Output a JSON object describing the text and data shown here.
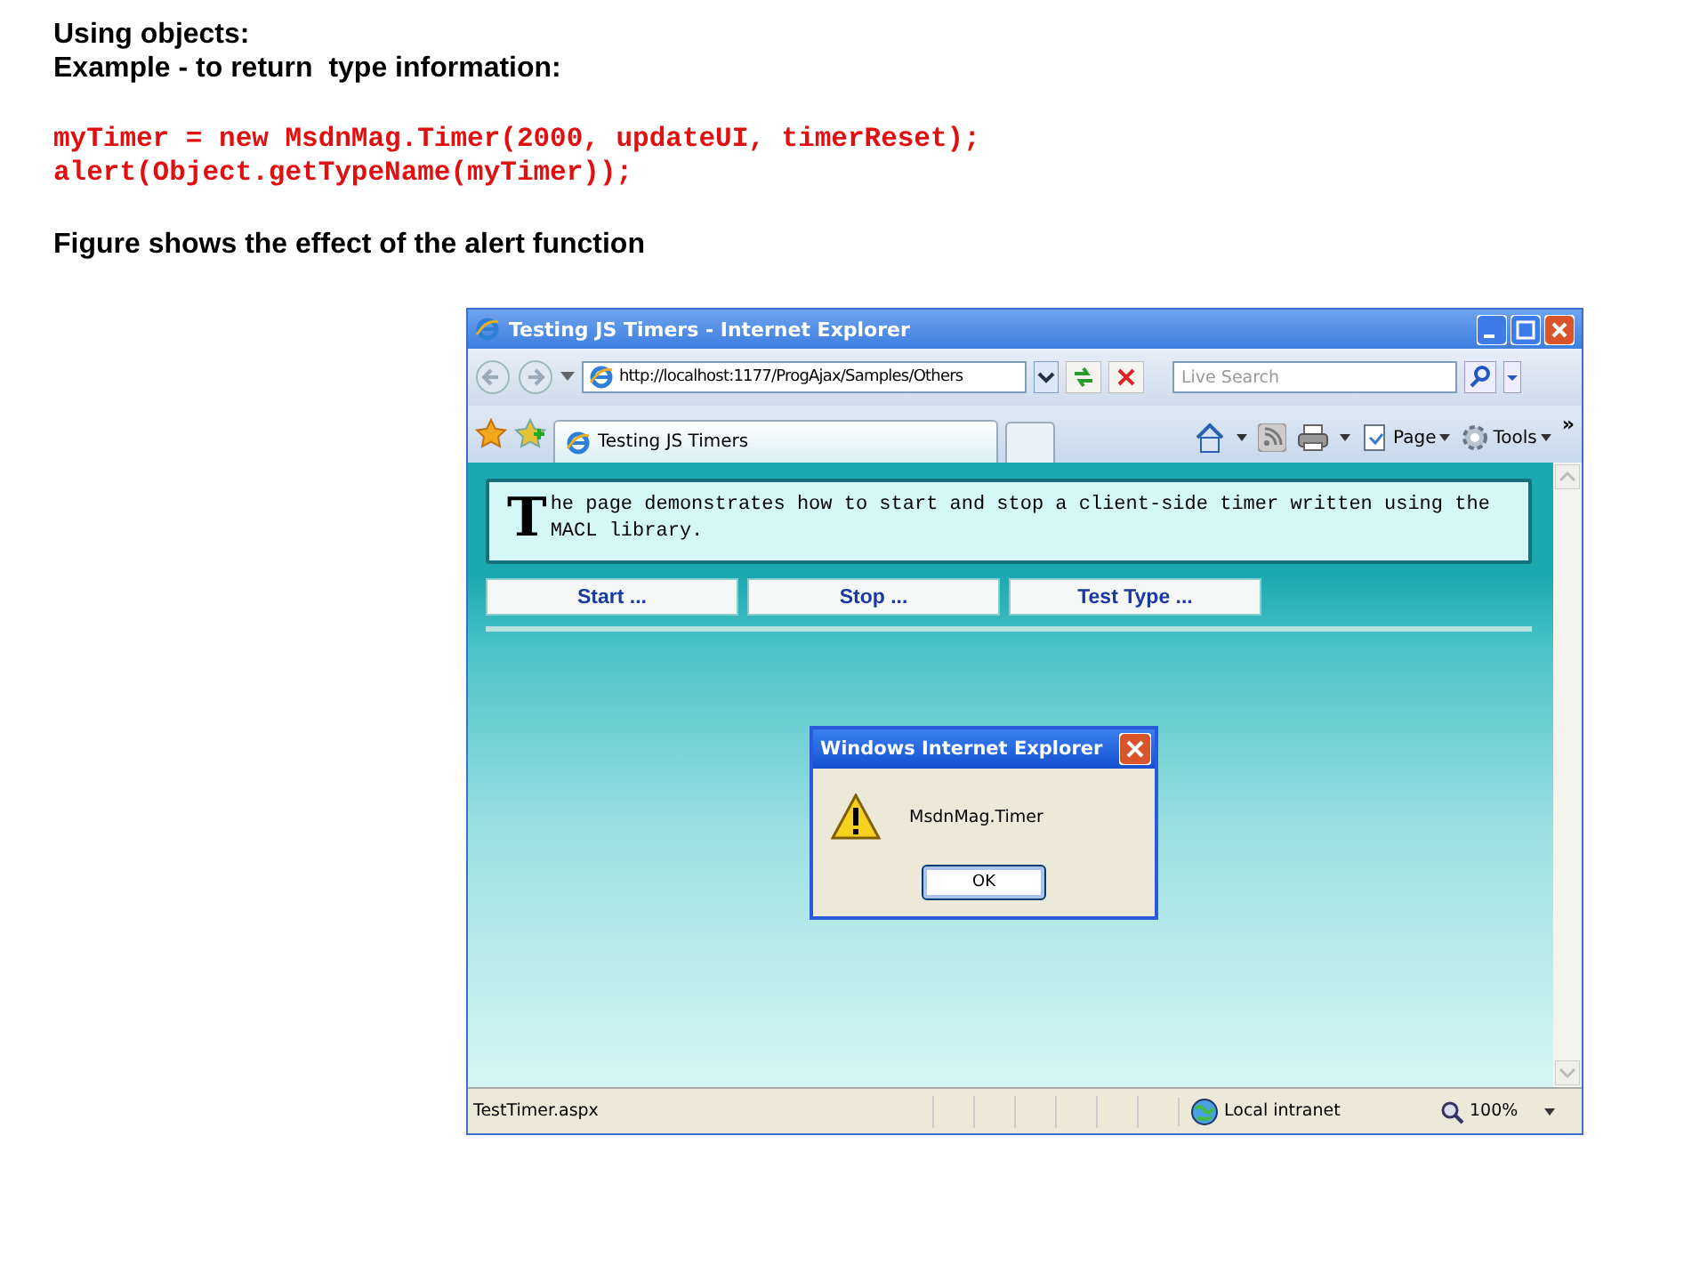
{
  "slide": {
    "heading": "Using objects:",
    "subheading": "Example - to return  type information:",
    "code": [
      "myTimer = new MsdnMag.Timer(2000, updateUI, timerReset);",
      "alert(Object.getTypeName(myTimer));"
    ],
    "caption": "Figure shows the effect of the alert function"
  },
  "window": {
    "title": "Testing JS Timers - Internet Explorer"
  },
  "address_bar": {
    "url": "http://localhost:1177/ProgAjax/Samples/Others"
  },
  "search": {
    "placeholder": "Live Search"
  },
  "tabs": [
    {
      "label": "Testing JS Timers",
      "selected": true
    }
  ],
  "toolbar": [
    {
      "label": "Page"
    },
    {
      "label": "Tools"
    }
  ],
  "toolbar_more": "»",
  "page": {
    "intro_initial": "T",
    "intro": "he page demonstrates how to start and stop a client-side timer written using the MACL library.",
    "buttons": [
      "Start ...",
      "Stop ...",
      "Test Type ..."
    ]
  },
  "dialog": {
    "title": "Windows Internet Explorer",
    "message": "MsdnMag.Timer",
    "button": "OK"
  },
  "status_bar": {
    "text": "TestTimer.aspx",
    "zone": "Local intranet",
    "zoom": "100%"
  }
}
